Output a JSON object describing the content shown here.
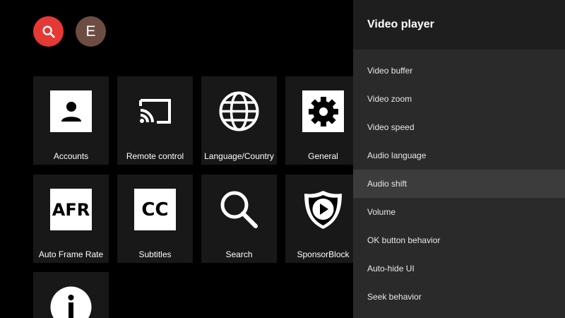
{
  "top": {
    "search_icon": "search-icon",
    "avatar_letter": "E",
    "colors": {
      "search_button": "#e53935",
      "avatar": "#6d4c41"
    }
  },
  "tiles": [
    {
      "label": "Accounts",
      "icon": "account-icon"
    },
    {
      "label": "Remote control",
      "icon": "cast-icon"
    },
    {
      "label": "Language/Country",
      "icon": "globe-icon"
    },
    {
      "label": "General",
      "icon": "gear-icon"
    },
    {
      "label": "Auto Frame Rate",
      "icon": "afr-icon",
      "icon_text": "AFR"
    },
    {
      "label": "Subtitles",
      "icon": "closed-captions-icon",
      "icon_text": "CC"
    },
    {
      "label": "Search",
      "icon": "magnifier-icon"
    },
    {
      "label": "SponsorBlock",
      "icon": "sponsorblock-icon"
    },
    {
      "label": "",
      "icon": "info-icon"
    }
  ],
  "panel": {
    "title": "Video player",
    "items": [
      "Video buffer",
      "Video zoom",
      "Video speed",
      "Audio language",
      "Audio shift",
      "Volume",
      "OK button behavior",
      "Auto-hide UI",
      "Seek behavior"
    ],
    "selected": "Audio shift"
  }
}
